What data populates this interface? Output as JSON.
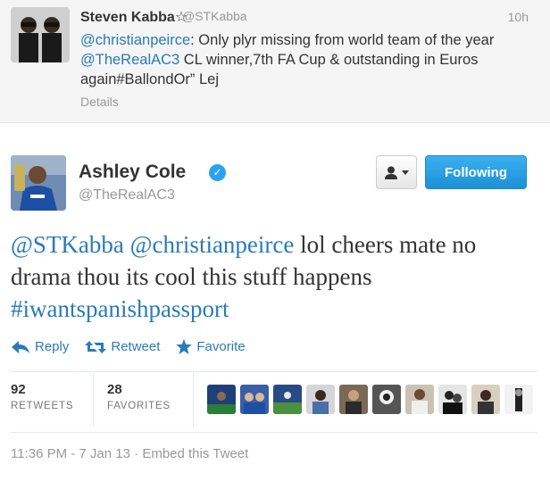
{
  "parent_tweet": {
    "name": "Steven Kabba☆",
    "handle": "@STKabba",
    "time": "10h",
    "mention": "@christianpeirce",
    "text_1": ": Only plyr missing from world team of the year ",
    "mention_2": "@TheRealAC3",
    "text_2": " CL winner,7th FA Cup & outstanding in Euros again#BallondOr” Lej",
    "details": "Details"
  },
  "tweet": {
    "name": "Ashley Cole",
    "handle": "@TheRealAC3",
    "following_label": "Following",
    "mention_1": "@STKabba",
    "mention_2": "@christianpeirce",
    "text": " lol cheers mate no drama thou its cool this stuff happens ",
    "hashtag": "#iwantspanishpassport"
  },
  "actions": {
    "reply": "Reply",
    "retweet": "Retweet",
    "favorite": "Favorite"
  },
  "stats": {
    "retweets_count": "92",
    "retweets_label": "RETWEETS",
    "favorites_count": "28",
    "favorites_label": "FAVORITES"
  },
  "footer": {
    "timestamp": "11:36 PM - 7 Jan 13",
    "separator": "·",
    "embed": "Embed this Tweet"
  },
  "colors": {
    "link": "#2b7bb9",
    "follow_button": "#2aa3ef"
  }
}
